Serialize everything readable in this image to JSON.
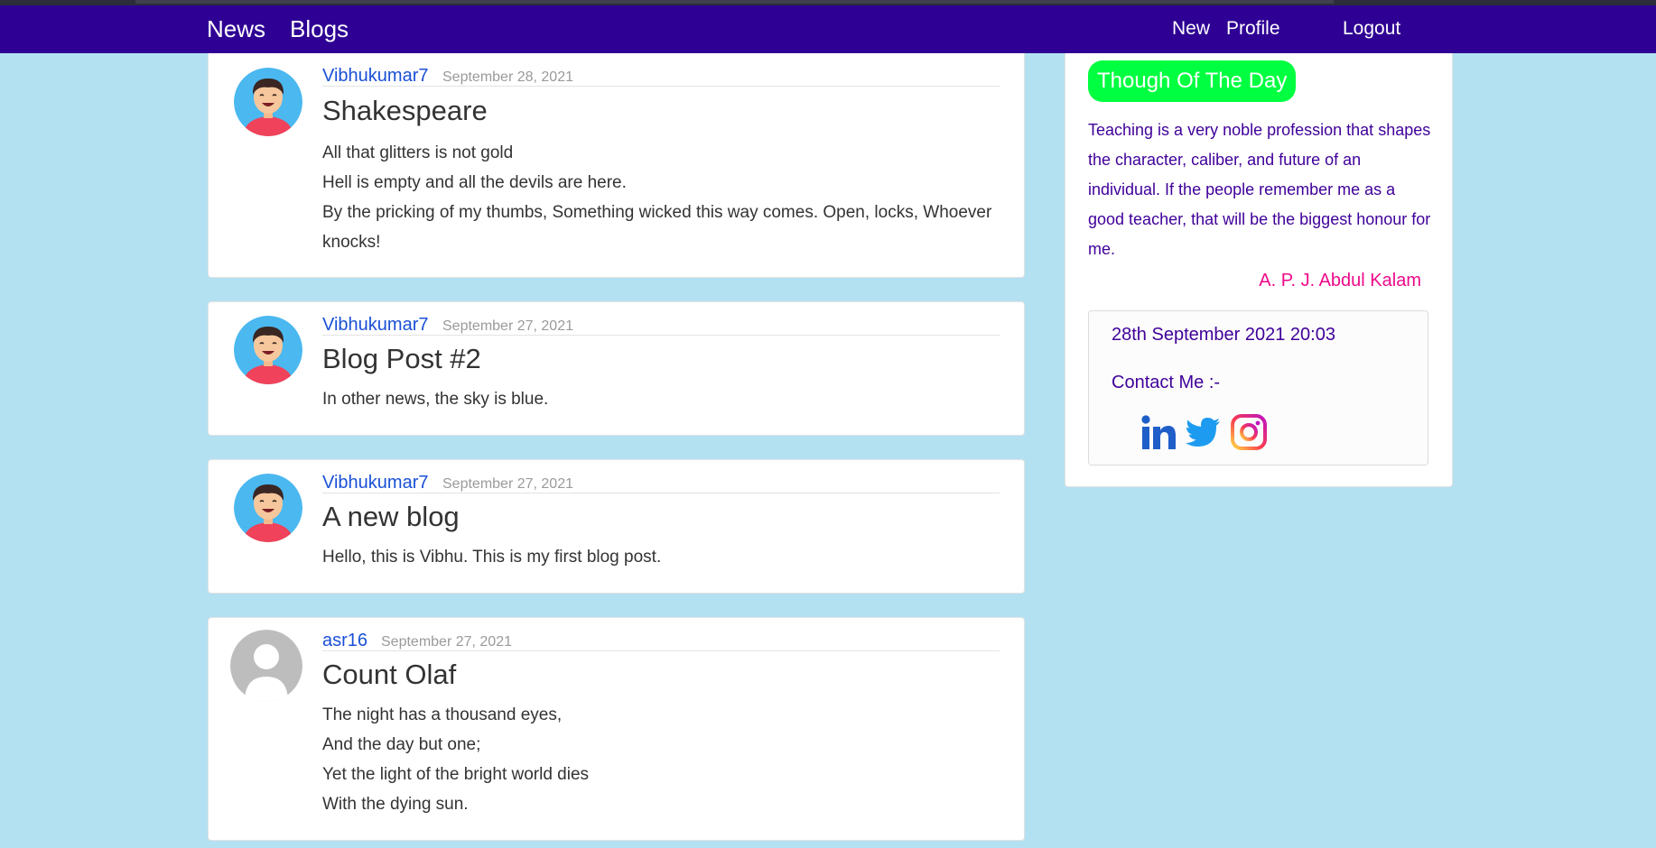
{
  "nav": {
    "left": [
      "News",
      "Blogs"
    ],
    "right": [
      "New",
      "Profile",
      "Logout"
    ],
    "color": "#2e0094"
  },
  "posts": [
    {
      "author": "Vibhukumar7",
      "date": "September 28, 2021",
      "title": "Shakespeare",
      "lines": [
        "All that glitters is not gold",
        "Hell is empty and all the devils are here.",
        "By the pricking of my thumbs, Something wicked this way comes. Open, locks, Whoever knocks!"
      ],
      "avatar": "cartoon-boy-avatar"
    },
    {
      "author": "Vibhukumar7",
      "date": "September 27, 2021",
      "title": "Blog Post #2",
      "lines": [
        "In other news, the sky is blue."
      ],
      "avatar": "cartoon-boy-avatar"
    },
    {
      "author": "Vibhukumar7",
      "date": "September 27, 2021",
      "title": "A new blog",
      "lines": [
        "Hello, this is Vibhu. This is my first blog post."
      ],
      "avatar": "cartoon-boy-avatar"
    },
    {
      "author": "asr16",
      "date": "September 27, 2021",
      "title": "Count Olaf",
      "lines": [
        "The night has a thousand eyes,",
        "And the day but one;",
        "Yet the light of the bright world dies",
        "With the dying sun."
      ],
      "avatar": "default-user-avatar"
    }
  ],
  "sidebar": {
    "badge": "Though Of The Day",
    "quote": "Teaching is a very noble profession that shapes the character, caliber, and future of an individual. If the people remember me as a good teacher, that will be the biggest honour for me.",
    "quote_author": "A. P. J. Abdul Kalam",
    "datetime": "28th September 2021 20:03",
    "contact_label": "Contact Me :-",
    "social": [
      "linkedin-icon",
      "twitter-icon",
      "instagram-icon"
    ]
  },
  "colors": {
    "background": "#b3e1f1",
    "author_link": "#1a50d6",
    "badge": "#00ff40",
    "quote": "#3f0099",
    "quote_author": "#ee0a8a"
  }
}
